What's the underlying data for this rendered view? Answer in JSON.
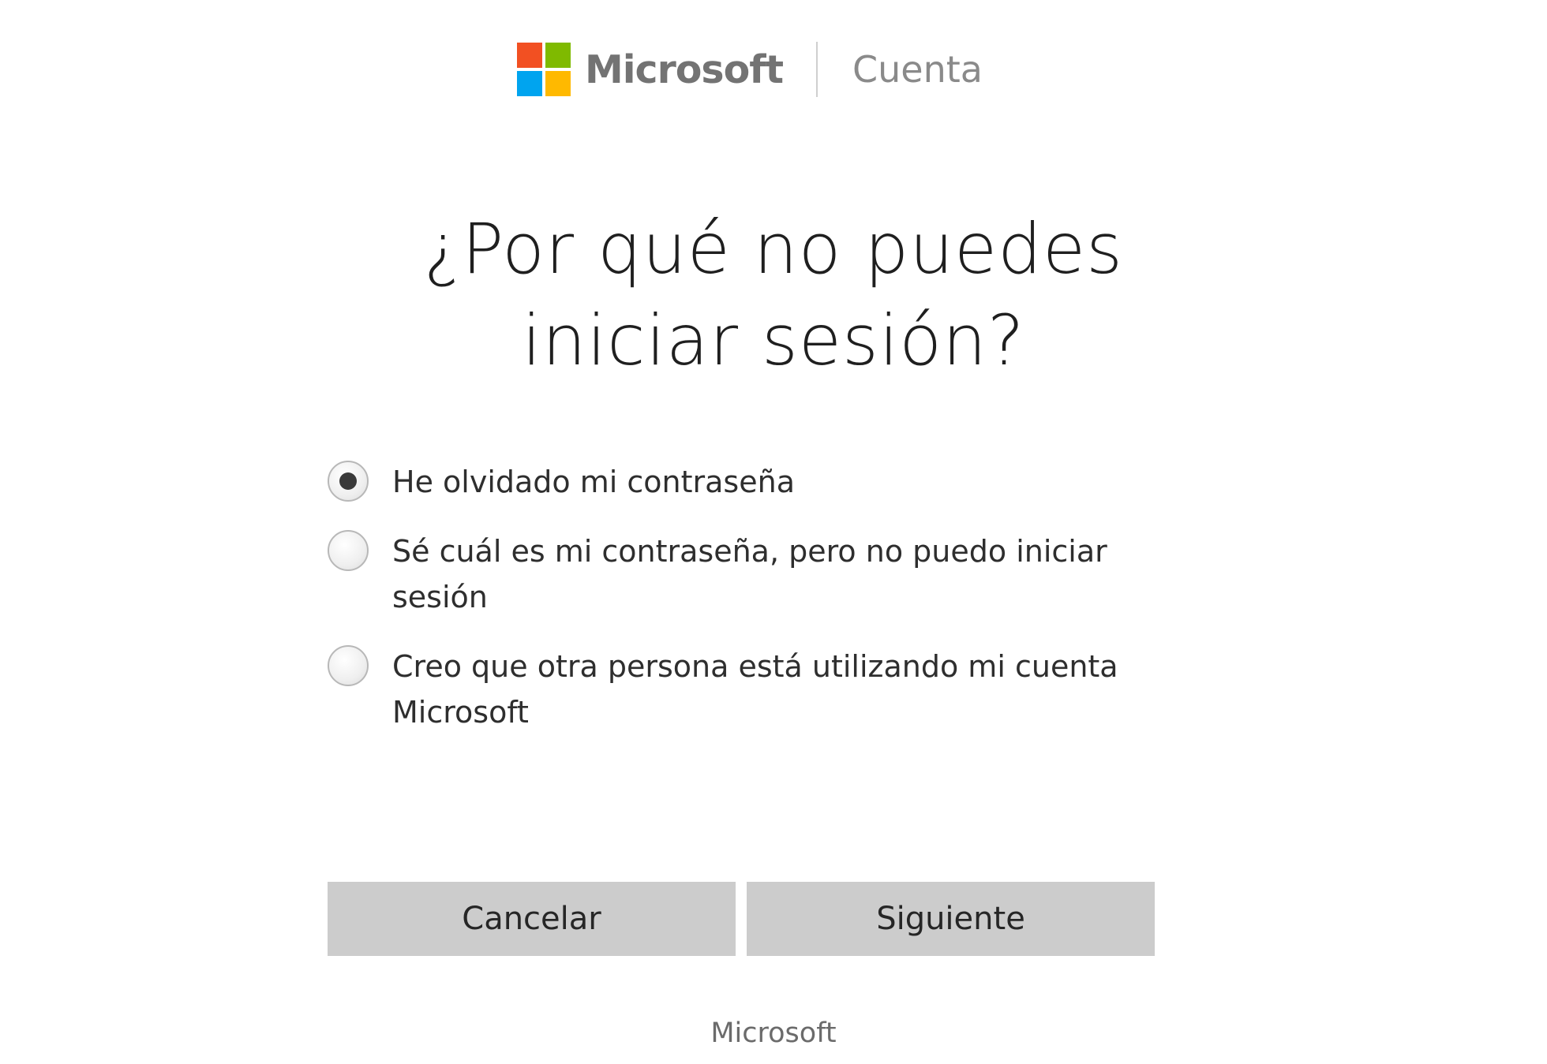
{
  "header": {
    "brand": "Microsoft",
    "section": "Cuenta",
    "logo_colors": [
      "#f25022",
      "#7fba00",
      "#00a4ef",
      "#ffb900"
    ]
  },
  "title": {
    "line1": "¿Por qué no puedes",
    "line2": "iniciar sesión?"
  },
  "options": [
    {
      "line1": "He olvidado mi contraseña",
      "line2": "",
      "checked": true
    },
    {
      "line1": "Sé cuál es mi contraseña, pero no puedo iniciar",
      "line2": "sesión",
      "checked": false
    },
    {
      "line1": "Creo que otra persona está utilizando mi cuenta",
      "line2": "Microsoft",
      "checked": false
    }
  ],
  "buttons": {
    "cancel": "Cancelar",
    "next": "Siguiente"
  },
  "footer": {
    "text": "Microsoft"
  }
}
